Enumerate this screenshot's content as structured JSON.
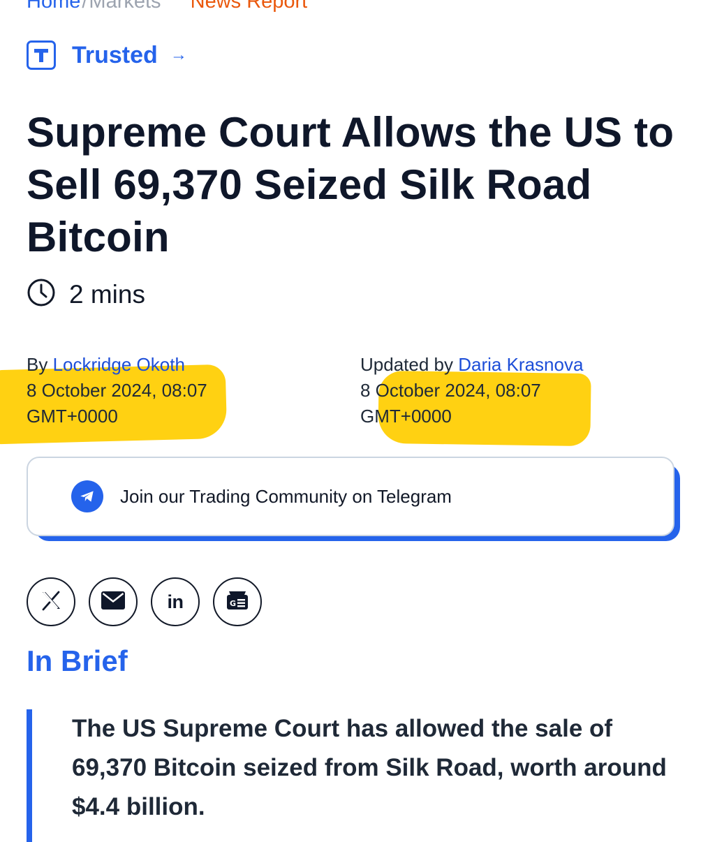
{
  "breadcrumb": {
    "home": "Home",
    "separator": "/",
    "markets": "Markets",
    "report": "News Report"
  },
  "trusted": {
    "logo_letter": "T",
    "label": "Trusted",
    "arrow": "→"
  },
  "headline": "Supreme Court Allows the US to Sell 69,370 Seized Silk Road Bitcoin",
  "read_time": "2 mins",
  "author": {
    "prefix": "By",
    "name": "Lockridge Okoth",
    "date": "8 October 2024, 08:07",
    "timezone": "GMT+0000"
  },
  "updater": {
    "prefix": "Updated by",
    "name": "Daria Krasnova",
    "date": "8 October 2024, 08:07",
    "timezone": "GMT+0000"
  },
  "telegram": {
    "label": "Join our Trading Community on Telegram",
    "icon": "telegram-icon"
  },
  "share": [
    "x-icon",
    "email-icon",
    "linkedin-icon",
    "google-news-icon"
  ],
  "linkedin_text": "in",
  "brief": {
    "title": "In Brief",
    "text": "The US Supreme Court has allowed the sale of 69,370 Bitcoin seized from Silk Road, worth around $4.4 billion."
  },
  "colors": {
    "accent": "#2563eb",
    "breadcrumb_report": "#ea580c",
    "highlighter": "#ffcd00",
    "text": "#111827"
  }
}
